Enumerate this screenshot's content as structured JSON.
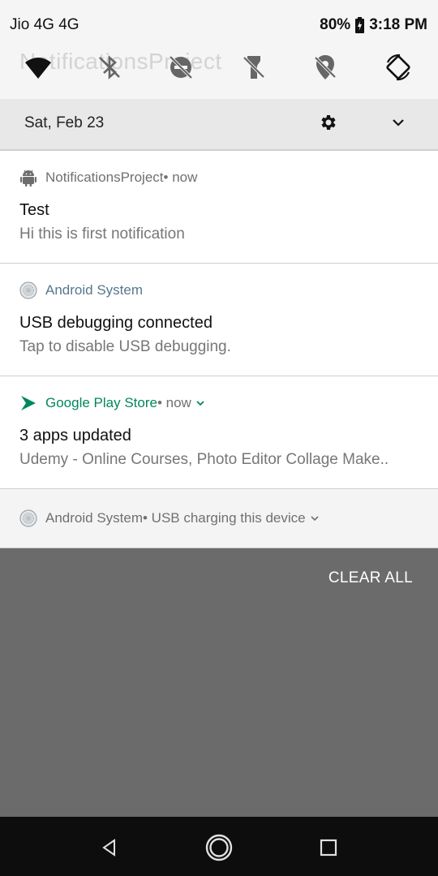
{
  "status_bar": {
    "carrier": "Jio 4G 4G",
    "battery": "80%",
    "time": "3:18 PM"
  },
  "background_ghost_text": "NotificationsProject",
  "quick_settings": {
    "tiles": [
      "wifi-icon",
      "bluetooth-off-icon",
      "do-not-disturb-off-icon",
      "flashlight-off-icon",
      "location-off-icon",
      "auto-rotate-icon"
    ]
  },
  "date_bar": {
    "date": "Sat, Feb 23"
  },
  "notifications": [
    {
      "app": "NotificationsProject",
      "time": " • now",
      "title": "Test",
      "text": "Hi this is first notification"
    },
    {
      "app": "Android System",
      "title": "USB debugging connected",
      "text": "Tap to disable USB debugging."
    },
    {
      "app": "Google Play Store",
      "time": " • now",
      "title": "3 apps updated",
      "text": "Udemy - Online Courses, Photo Editor Collage Make.."
    },
    {
      "app": "Android System",
      "summary": " • USB charging this device"
    }
  ],
  "clear_all": "CLEAR ALL",
  "colors": {
    "play_store_green": "#01875f",
    "android_system_blue": "#55798c",
    "scrim": "#6b6b6b"
  }
}
